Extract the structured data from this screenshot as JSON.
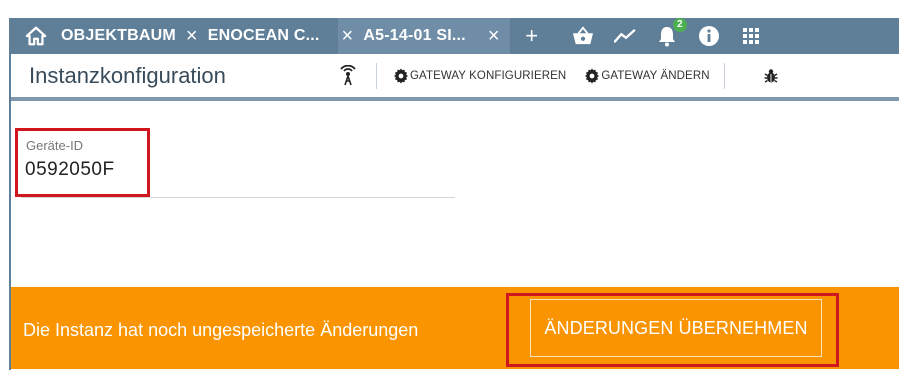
{
  "topbar": {
    "tabs": [
      {
        "label": "OBJEKTBAUM"
      },
      {
        "label": "ENOCEAN C..."
      },
      {
        "label": "A5-14-01 SI..."
      }
    ],
    "add_tab_label": "+",
    "close_glyph": "×",
    "notification_count": "2",
    "icons": [
      "home-icon",
      "basket-icon",
      "trend-icon",
      "bell-icon",
      "info-icon",
      "apps-grid-icon"
    ]
  },
  "toolbar": {
    "title": "Instanzkonfiguration",
    "configure_gateway_label": "GATEWAY KONFIGURIEREN",
    "change_gateway_label": "GATEWAY ÄNDERN",
    "icons": [
      "signal-icon",
      "gear-icon",
      "bug-icon"
    ]
  },
  "form": {
    "device_id_label": "Geräte-ID",
    "device_id_value": "0592050F"
  },
  "warning": {
    "message": "Die Instanz hat noch ungespeicherte Änderungen",
    "apply_label": "ÄNDERUNGEN ÜBERNEHMEN"
  },
  "colors": {
    "topbar": "#5f7e98",
    "warning": "#fa9400",
    "highlight": "#d0161e",
    "title": "#384b5b"
  }
}
